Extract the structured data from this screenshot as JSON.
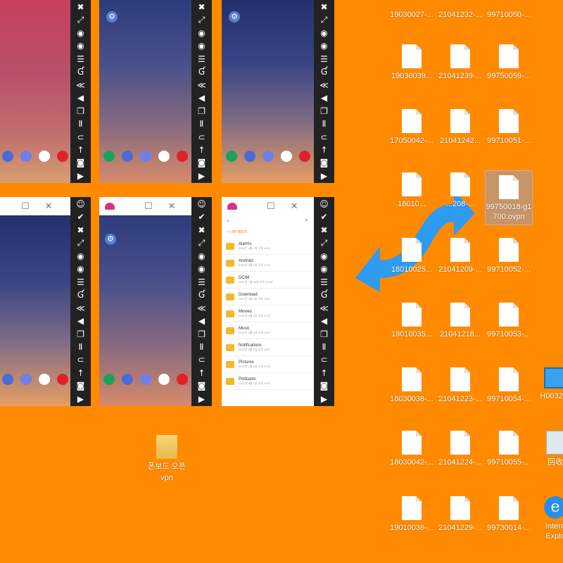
{
  "phones": {
    "top": [
      {
        "style": "pink"
      },
      {
        "style": "navy"
      },
      {
        "style": "navy2"
      }
    ],
    "bottom": [
      {
        "style": "navy2"
      },
      {
        "style": "navy"
      },
      {
        "style": "filemanager"
      }
    ]
  },
  "toolbar_icons": [
    "⚠",
    "✕",
    "✥",
    "◉",
    "◉",
    "☰",
    "Ɠ",
    "≪",
    "◀",
    "Ϝ",
    "▣",
    "Ⅱ",
    "⊂",
    "↑",
    "◉",
    "▶"
  ],
  "file_manager": {
    "breadcrumb": "> 내장 메모리",
    "rows": [
      {
        "name": "Alarms",
        "sub": "2021년 4월 1일 오후 4:00"
      },
      {
        "name": "Android",
        "sub": "2021년 4월 1일 오후 4:00"
      },
      {
        "name": "DCIM",
        "sub": "2021년 7월 19일 오후 12:38"
      },
      {
        "name": "Download",
        "sub": "2021년 4월 1일 오후 4:00"
      },
      {
        "name": "Movies",
        "sub": "2021년 4월 1일 오후 4:00"
      },
      {
        "name": "Music",
        "sub": "2021년 4월 1일 오후 4:00"
      },
      {
        "name": "Notifications",
        "sub": "2021년 4월 1일 오후 4:00"
      },
      {
        "name": "Pictures",
        "sub": "2021년 4월 1일 오후 4:00"
      },
      {
        "name": "Podcasts",
        "sub": "2021년 4월 1일 오후 4:00"
      }
    ]
  },
  "desktop": {
    "folder": {
      "label1": "폰보드 오픈",
      "label2": "vpn"
    },
    "files": [
      {
        "label": "19030027-..."
      },
      {
        "label": "21041232-..."
      },
      {
        "label": "99710050-..."
      },
      {
        "label": "19030039..."
      },
      {
        "label": "21041239-..."
      },
      {
        "label": "99750059-..."
      },
      {
        "label": "17050042-..."
      },
      {
        "label": "21041242..."
      },
      {
        "label": "99710051-..."
      },
      {
        "label": "18010..."
      },
      {
        "label": "...208-..."
      },
      {
        "label": "99750018-g1700.ovpn"
      },
      {
        "label": "18010025..."
      },
      {
        "label": "21041209-..."
      },
      {
        "label": "99710052-..."
      },
      {
        "label": "18010035..."
      },
      {
        "label": "21041218..."
      },
      {
        "label": "99710053-..."
      },
      {
        "label": "18030038-..."
      },
      {
        "label": "21041223-..."
      },
      {
        "label": "99710054-..."
      },
      {
        "label": "18030042-..."
      },
      {
        "label": "21041224-..."
      },
      {
        "label": "99710055-..."
      },
      {
        "label": "19010036-..."
      },
      {
        "label": "21041229-..."
      },
      {
        "label": "99730014-..."
      }
    ],
    "system": [
      {
        "label": "H0032-..."
      },
      {
        "label": "回收"
      },
      {
        "label": "Intern Explo"
      }
    ]
  },
  "colors": {
    "desktop_bg": "#ff8a00",
    "arrow": "#2f9bf0"
  }
}
